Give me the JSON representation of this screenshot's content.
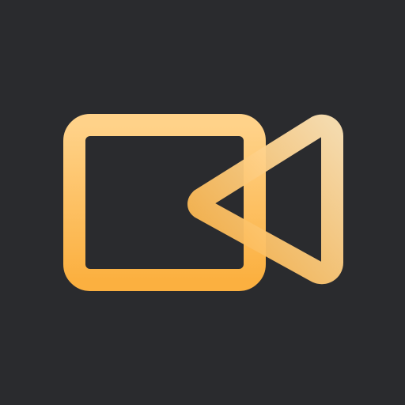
{
  "app_icon": {
    "name": "video-camera-icon",
    "colors": {
      "background": "#2a2b2e",
      "gradient_light": "#ffe3b3",
      "gradient_mid": "#ffd289",
      "gradient_dark": "#fbb040"
    }
  }
}
